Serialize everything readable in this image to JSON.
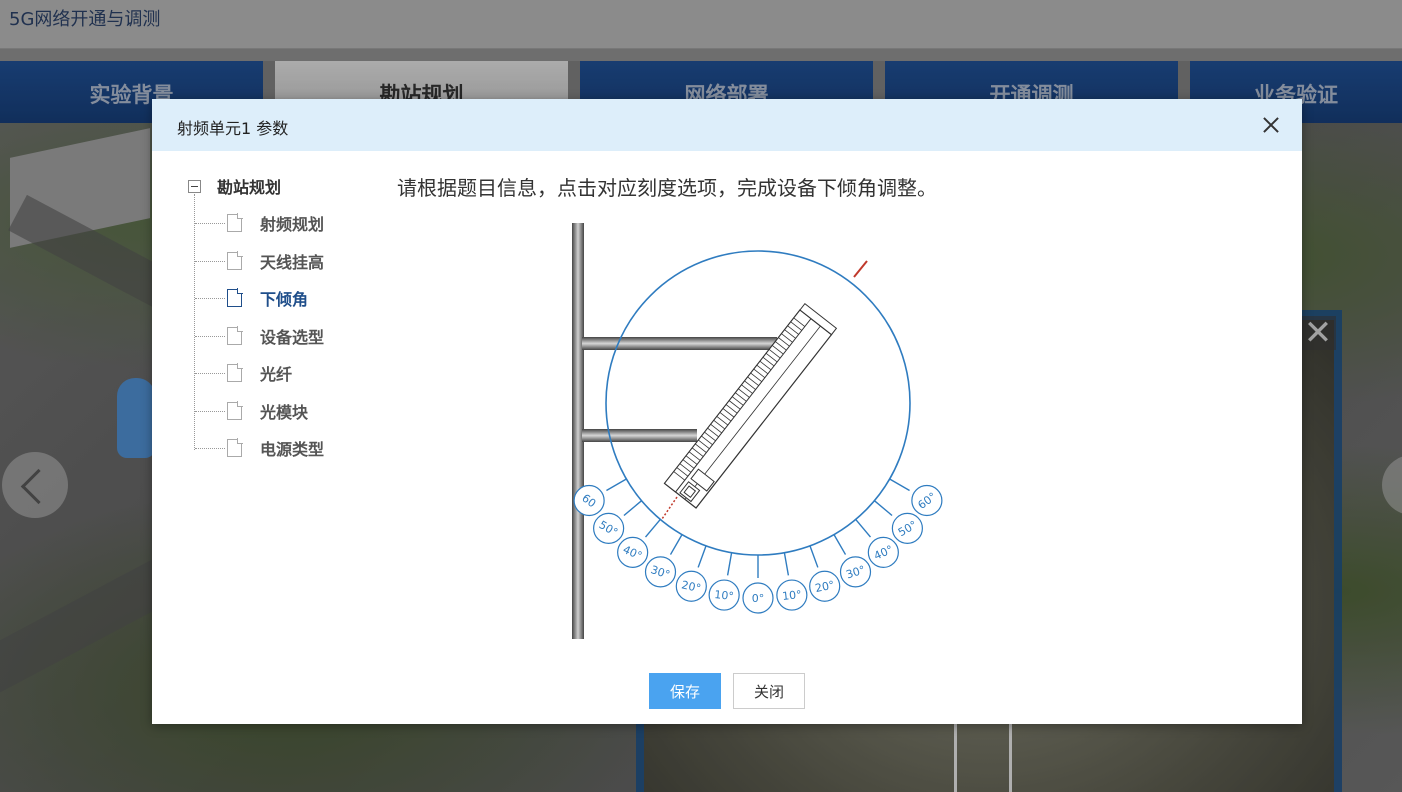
{
  "app": {
    "title": "5G网络开通与调测",
    "tabs": [
      {
        "label": "实验背景"
      },
      {
        "label": "勘站规划"
      },
      {
        "label": "网络部署"
      },
      {
        "label": "开通调测"
      },
      {
        "label": "业务验证"
      }
    ]
  },
  "dialog": {
    "title": "射频单元1 参数",
    "tree": {
      "root": "勘站规划",
      "items": [
        {
          "label": "射频规划"
        },
        {
          "label": "天线挂高"
        },
        {
          "label": "下倾角"
        },
        {
          "label": "设备选型"
        },
        {
          "label": "光纤"
        },
        {
          "label": "光模块"
        },
        {
          "label": "电源类型"
        }
      ],
      "active_index": 2
    },
    "instruction": "请根据题目信息，点击对应刻度选项，完成设备下倾角调整。",
    "scale_left": [
      "60",
      "50°",
      "40°",
      "30°",
      "20°",
      "10°"
    ],
    "scale_center": "0°",
    "scale_right": [
      "10°",
      "20°",
      "30°",
      "40°",
      "50°",
      "60°"
    ],
    "buttons": {
      "save": "保存",
      "close": "关闭"
    }
  },
  "colors": {
    "accent": "#4aa3f0",
    "header_bg": "#ddeefa",
    "nav_blue": "#1f4e91",
    "dial_blue": "#2f7cc0",
    "indicator_red": "#c0392b"
  }
}
